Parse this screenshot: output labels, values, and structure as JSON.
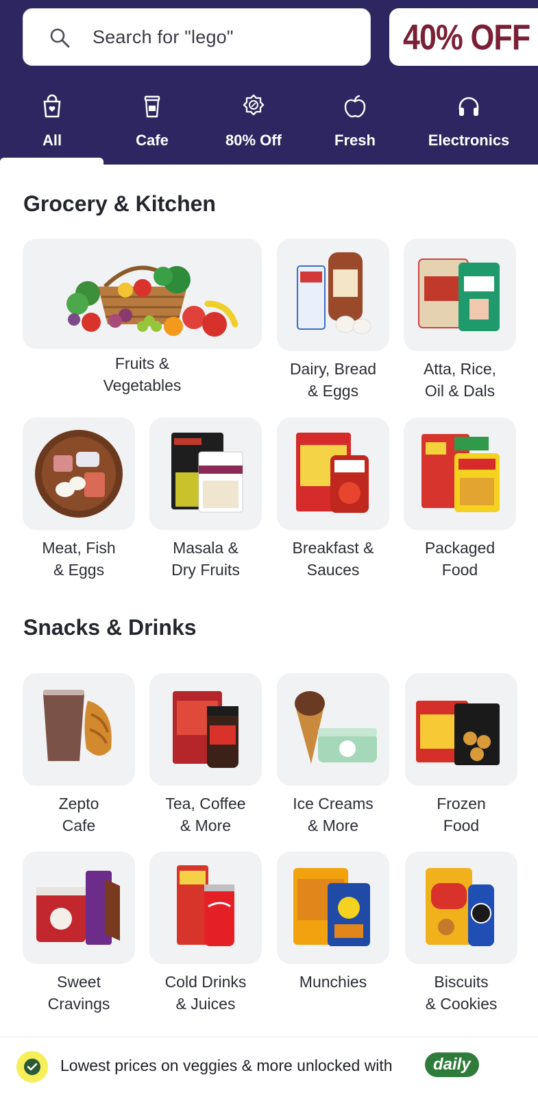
{
  "header": {
    "search": {
      "placeholder": "Search for \"lego\"",
      "icon": "search-icon"
    },
    "promo": {
      "label": "40% OFF",
      "color": "#7a1f35"
    },
    "background_color": "#2d2660"
  },
  "tabs": [
    {
      "label": "All",
      "icon": "shopping-bag-icon",
      "selected": true
    },
    {
      "label": "Cafe",
      "icon": "coffee-cup-icon",
      "selected": false
    },
    {
      "label": "80% Off",
      "icon": "discount-badge-icon",
      "selected": false
    },
    {
      "label": "Fresh",
      "icon": "apple-icon",
      "selected": false
    },
    {
      "label": "Electronics",
      "icon": "headphones-icon",
      "selected": false
    }
  ],
  "sections": [
    {
      "title": "Grocery & Kitchen",
      "items": [
        {
          "label": "Fruits &\nVegetables",
          "icon": "fruit-basket-image"
        },
        {
          "label": "Dairy, Bread\n& Eggs",
          "icon": "dairy-bread-image"
        },
        {
          "label": "Atta, Rice,\nOil & Dals",
          "icon": "atta-rice-image"
        },
        {
          "label": "Meat, Fish\n& Eggs",
          "icon": "meat-fish-image"
        },
        {
          "label": "Masala &\nDry Fruits",
          "icon": "masala-image"
        },
        {
          "label": "Breakfast &\nSauces",
          "icon": "breakfast-image"
        },
        {
          "label": "Packaged\nFood",
          "icon": "packaged-food-image"
        }
      ]
    },
    {
      "title": "Snacks & Drinks",
      "items": [
        {
          "label": "Zepto\nCafe",
          "icon": "zepto-cafe-image"
        },
        {
          "label": "Tea, Coffee\n& More",
          "icon": "tea-coffee-image"
        },
        {
          "label": "Ice Creams\n& More",
          "icon": "ice-cream-image"
        },
        {
          "label": "Frozen\nFood",
          "icon": "frozen-food-image"
        },
        {
          "label": "Sweet\nCravings",
          "icon": "sweets-image"
        },
        {
          "label": "Cold Drinks\n& Juices",
          "icon": "cold-drinks-image"
        },
        {
          "label": "Munchies",
          "icon": "munchies-image"
        },
        {
          "label": "Biscuits\n& Cookies",
          "icon": "biscuits-image"
        }
      ]
    }
  ],
  "bottom_bar": {
    "text": "Lowest prices on veggies & more unlocked with",
    "badge": "daily",
    "icon": "check-circle-icon"
  }
}
